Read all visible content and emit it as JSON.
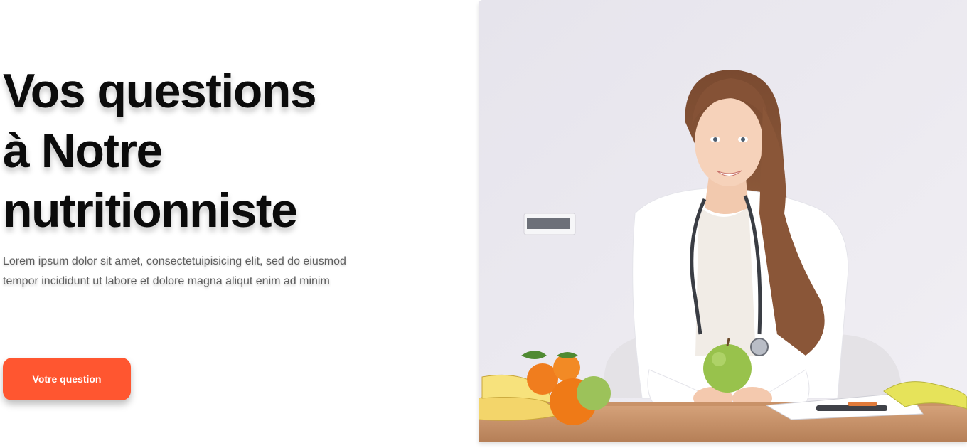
{
  "hero": {
    "title_lines": [
      "Vos questions",
      "à Notre",
      "nutritionniste"
    ],
    "description": "Lorem ipsum dolor sit amet, consectetuipisicing elit, sed do eiusmod tempor incididunt ut labore et dolore magna aliqut enim ad minim",
    "cta_label": "Votre question"
  },
  "colors": {
    "accent": "#ff5630",
    "title": "#0b0b0b",
    "body_text": "#5e5e5e",
    "background": "#ffffff"
  },
  "image": {
    "subject": "nutritionist-photo"
  }
}
